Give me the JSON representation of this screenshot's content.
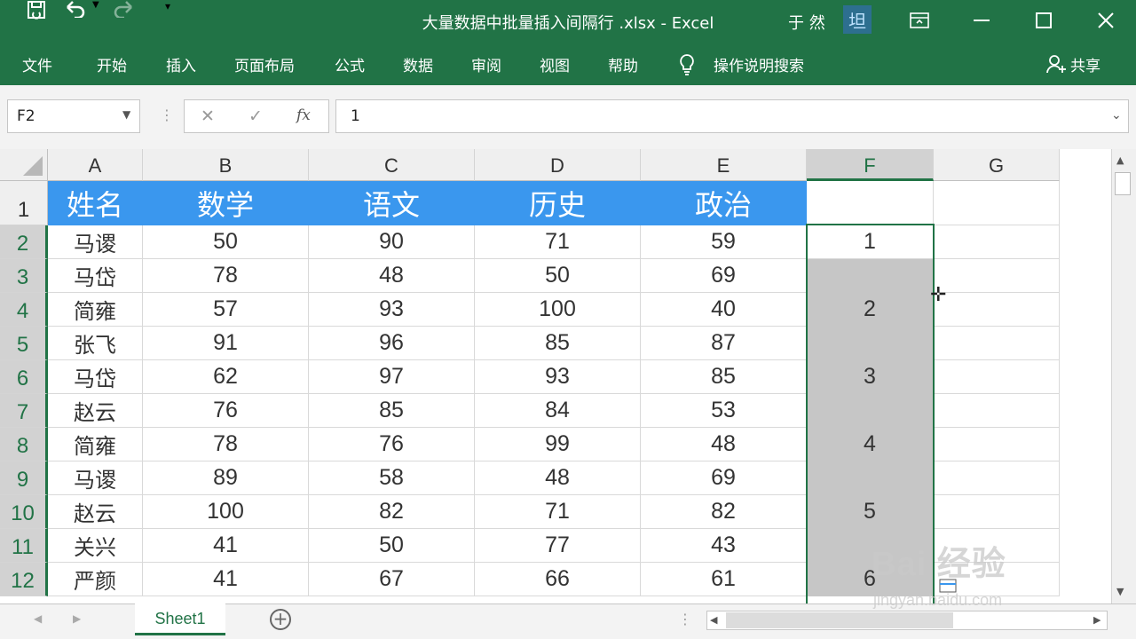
{
  "window": {
    "title": "大量数据中批量插入间隔行 .xlsx  -  Excel",
    "user": "于 然",
    "avatar_text": "坦"
  },
  "quick_access": {
    "save_icon": "save-icon",
    "undo_icon": "undo-icon",
    "redo_icon": "redo-icon",
    "customize_icon": "customize-icon"
  },
  "ribbon": {
    "tabs": [
      "文件",
      "开始",
      "插入",
      "页面布局",
      "公式",
      "数据",
      "审阅",
      "视图",
      "帮助"
    ],
    "tell_me": "操作说明搜索",
    "share": "共享"
  },
  "formula_bar": {
    "name_box": "F2",
    "formula": "1",
    "cancel_glyph": "✕",
    "enter_glyph": "✓",
    "fx_glyph": "fx"
  },
  "columns": [
    "A",
    "B",
    "C",
    "D",
    "E",
    "F",
    "G"
  ],
  "row_numbers": [
    "1",
    "2",
    "3",
    "4",
    "5",
    "6",
    "7",
    "8",
    "9",
    "10",
    "11",
    "12"
  ],
  "header_row": [
    "姓名",
    "数学",
    "语文",
    "历史",
    "政治"
  ],
  "data_rows": [
    [
      "马谡",
      "50",
      "90",
      "71",
      "59",
      "1"
    ],
    [
      "马岱",
      "78",
      "48",
      "50",
      "69",
      ""
    ],
    [
      "简雍",
      "57",
      "93",
      "100",
      "40",
      "2"
    ],
    [
      "张飞",
      "91",
      "96",
      "85",
      "87",
      ""
    ],
    [
      "马岱",
      "62",
      "97",
      "93",
      "85",
      "3"
    ],
    [
      "赵云",
      "76",
      "85",
      "84",
      "53",
      ""
    ],
    [
      "简雍",
      "78",
      "76",
      "99",
      "48",
      "4"
    ],
    [
      "马谡",
      "89",
      "58",
      "48",
      "69",
      ""
    ],
    [
      "赵云",
      "100",
      "82",
      "71",
      "82",
      "5"
    ],
    [
      "关兴",
      "41",
      "50",
      "77",
      "43",
      ""
    ],
    [
      "严颜",
      "41",
      "67",
      "66",
      "61",
      "6"
    ]
  ],
  "sheet_tabs": [
    "Sheet1"
  ],
  "watermark": {
    "text": "Bai 经验",
    "url": "jingyan.baidu.com"
  },
  "colors": {
    "excel_green": "#217346",
    "header_blue": "#3a97ee",
    "selection_gray": "#c6c6c6"
  }
}
